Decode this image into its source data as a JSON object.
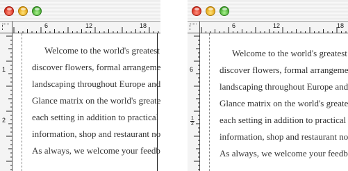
{
  "windows": [
    {
      "id": "left",
      "ruler_h_labels": [
        "6",
        "12",
        "18"
      ],
      "ruler_v_labels": [
        "1",
        "2"
      ],
      "lines": [
        "Welcome to the world's greatest liv",
        "discover flowers, formal arrangement",
        "landscaping throughout Europe and t",
        "Glance matrix on the world's greatest",
        "each setting in addition to practical in",
        "information, shop and restaurant not",
        "As always, we welcome your feedback"
      ]
    },
    {
      "id": "right",
      "ruler_h_labels": [
        "6",
        "12",
        "18"
      ],
      "ruler_v_labels": [
        "6",
        "1",
        "2"
      ],
      "lines": [
        "Welcome to the world's greatest liv",
        "discover flowers, formal arrangement",
        "landscaping throughout Europe and t",
        "Glance matrix on the world's greatest",
        "each setting in addition to practical in",
        "information, shop and restaurant not",
        "As always, we welcome your feedback"
      ]
    }
  ]
}
